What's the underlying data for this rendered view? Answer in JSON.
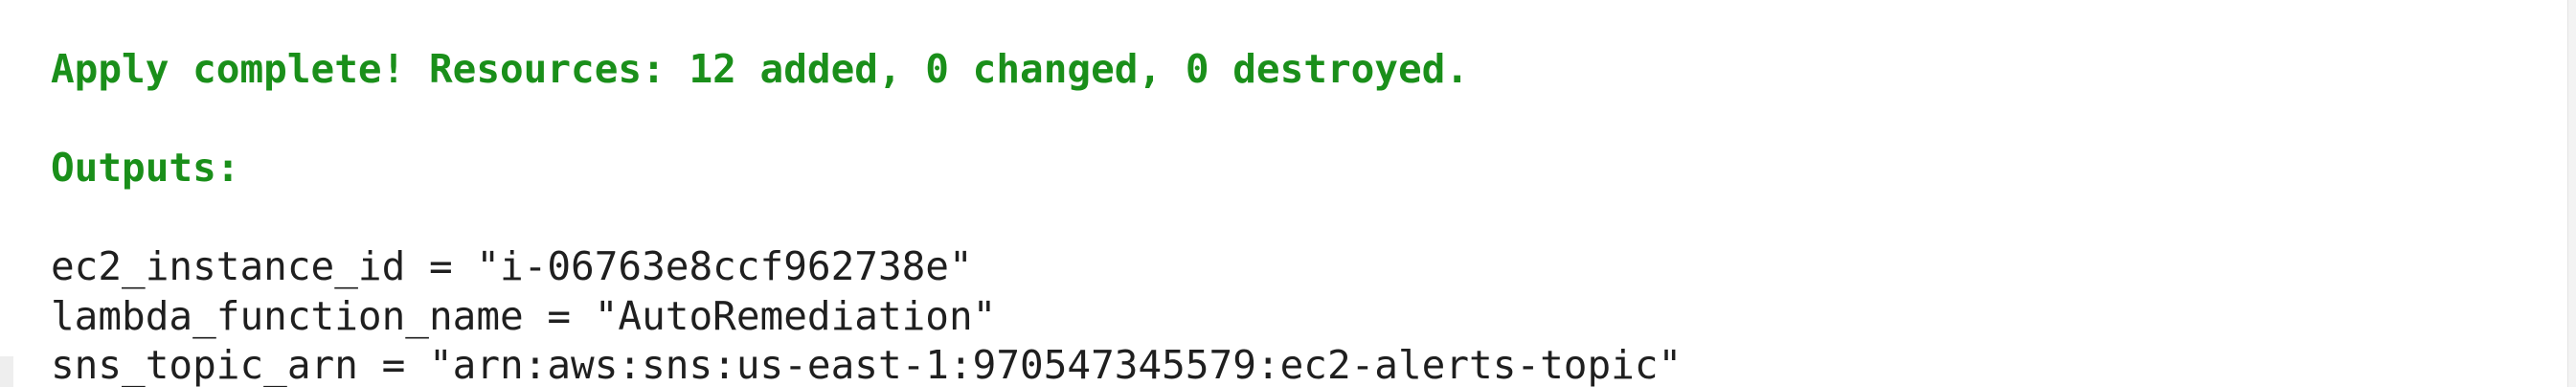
{
  "terminal": {
    "apply_status": "Apply complete! Resources: 12 added, 0 changed, 0 destroyed.",
    "outputs_header": "Outputs:",
    "outputs": [
      {
        "text": "ec2_instance_id = \"i-06763e8ccf962738e\""
      },
      {
        "text": "lambda_function_name = \"AutoRemediation\""
      },
      {
        "text": "sns_topic_arn = \"arn:aws:sns:us-east-1:970547345579:ec2-alerts-topic\""
      }
    ]
  },
  "colors": {
    "success_text": "#1a8f1a",
    "plain_text": "#1f1f1f",
    "background": "#ffffff"
  }
}
